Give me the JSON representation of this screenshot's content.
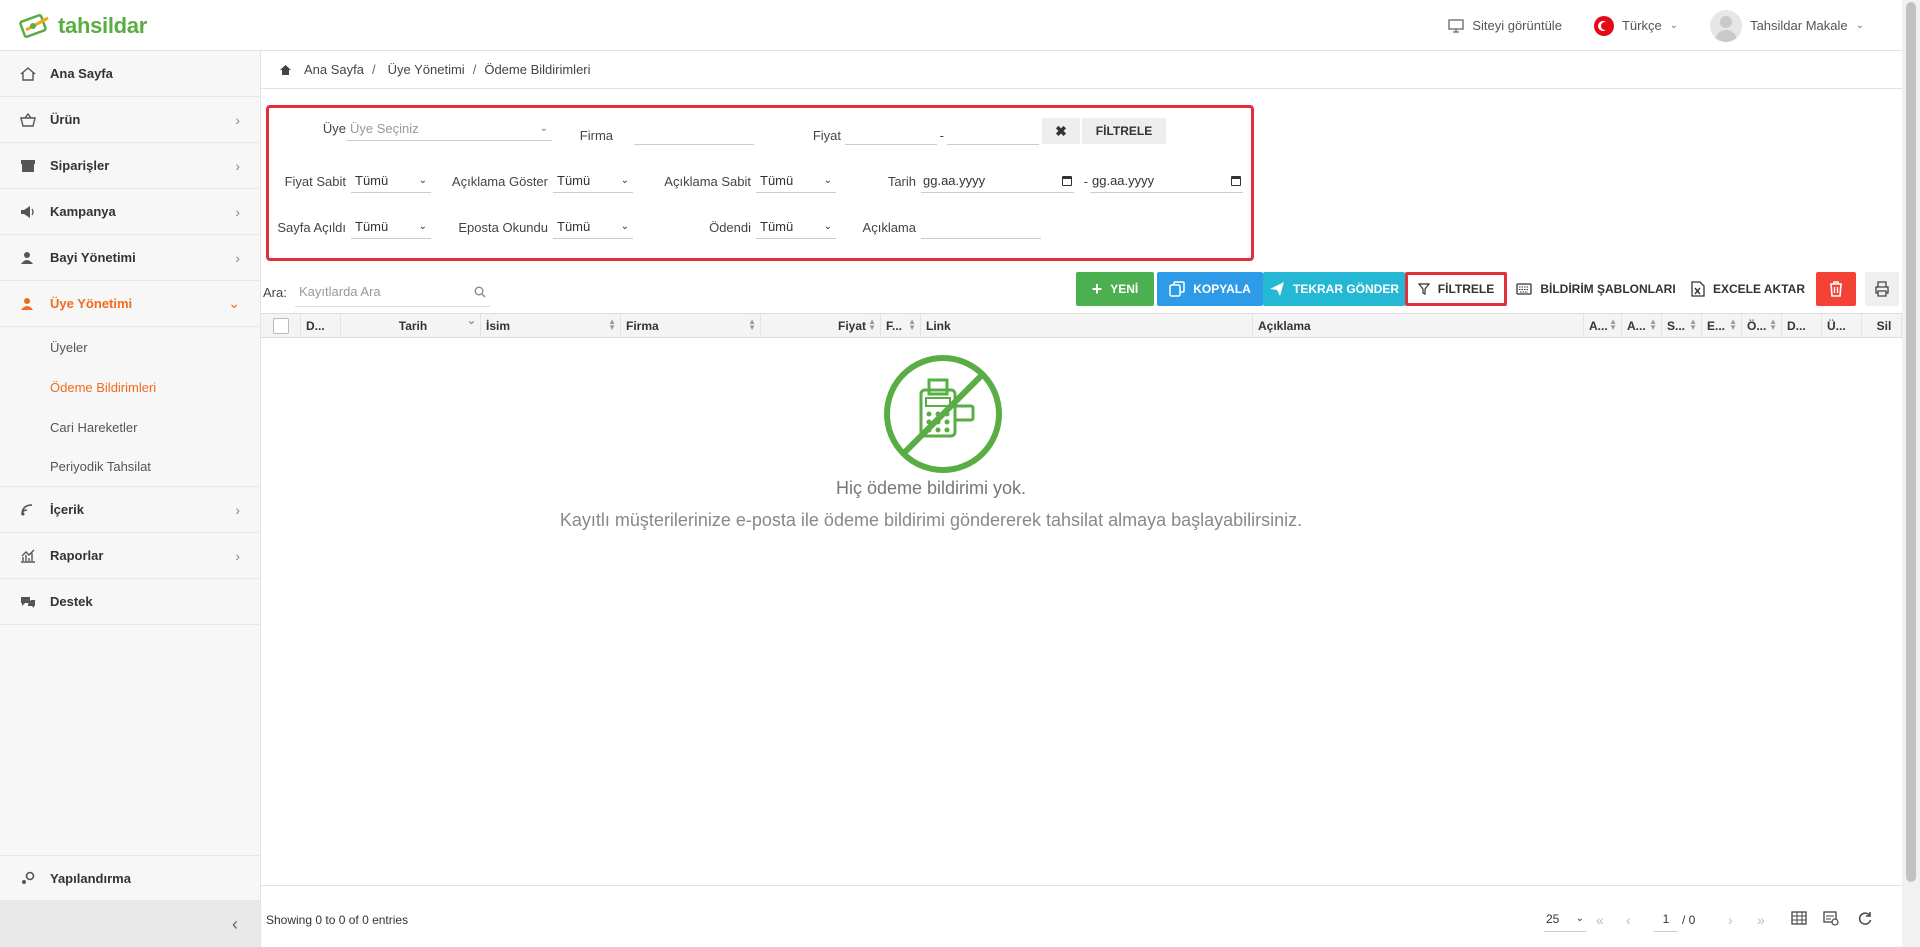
{
  "app": {
    "logo_text": "tahsildar"
  },
  "topbar": {
    "view_site": "Siteyi görüntüle",
    "language": "Türkçe",
    "user": "Tahsildar Makale"
  },
  "sidebar": {
    "items": [
      {
        "label": "Ana Sayfa",
        "icon": "home-icon"
      },
      {
        "label": "Ürün",
        "icon": "basket-icon"
      },
      {
        "label": "Siparişler",
        "icon": "store-icon"
      },
      {
        "label": "Kampanya",
        "icon": "megaphone-icon"
      },
      {
        "label": "Bayi Yönetimi",
        "icon": "dealer-icon"
      },
      {
        "label": "Üye Yönetimi",
        "icon": "user-icon"
      }
    ],
    "subitems": [
      "Üyeler",
      "Ödeme Bildirimleri",
      "Cari Hareketler",
      "Periyodik Tahsilat"
    ],
    "items2": [
      {
        "label": "İçerik",
        "icon": "content-icon"
      },
      {
        "label": "Raporlar",
        "icon": "chart-icon"
      },
      {
        "label": "Destek",
        "icon": "support-icon"
      }
    ],
    "config": "Yapılandırma",
    "collapse": "‹"
  },
  "breadcrumb": [
    "Ana Sayfa",
    "Üye Yönetimi",
    "Ödeme Bildirimleri"
  ],
  "filters": {
    "uye_label": "Üye",
    "uye_placeholder": "Üye Seçiniz",
    "firma_label": "Firma",
    "fiyat_label": "Fiyat",
    "dash": "-",
    "filter_button": "FİLTRELE",
    "fiyat_sabit_label": "Fiyat Sabit",
    "aciklama_goster_label": "Açıklama Göster",
    "aciklama_sabit_label": "Açıklama Sabit",
    "tarih_label": "Tarih",
    "date_placeholder": "gg.aa.yyyy",
    "sayfa_acildi_label": "Sayfa Açıldı",
    "eposta_okundu_label": "Eposta Okundu",
    "odendi_label": "Ödendi",
    "aciklama_label": "Açıklama",
    "tumu": "Tümü"
  },
  "toolbar": {
    "search_label": "Ara:",
    "search_placeholder": "Kayıtlarda Ara",
    "new": "YENİ",
    "copy": "KOPYALA",
    "resend": "TEKRAR GÖNDER",
    "filter": "FİLTRELE",
    "templates": "BİLDİRİM ŞABLONLARI",
    "excel": "EXCELE AKTAR"
  },
  "table": {
    "columns": [
      "D...",
      "Tarih",
      "İsim",
      "Firma",
      "Fiyat",
      "F...",
      "Link",
      "Açıklama",
      "A...",
      "A...",
      "S...",
      "E...",
      "Ö...",
      "D...",
      "Ü...",
      "Sil"
    ]
  },
  "empty": {
    "title": "Hiç ödeme bildirimi yok.",
    "subtitle": "Kayıtlı müşterilerinize e-posta ile ödeme bildirimi göndererek tahsilat almaya başlayabilirsiniz."
  },
  "footer": {
    "info": "Showing 0 to 0 of 0 entries",
    "page_size": "25",
    "page": "1",
    "of": "/ 0"
  }
}
